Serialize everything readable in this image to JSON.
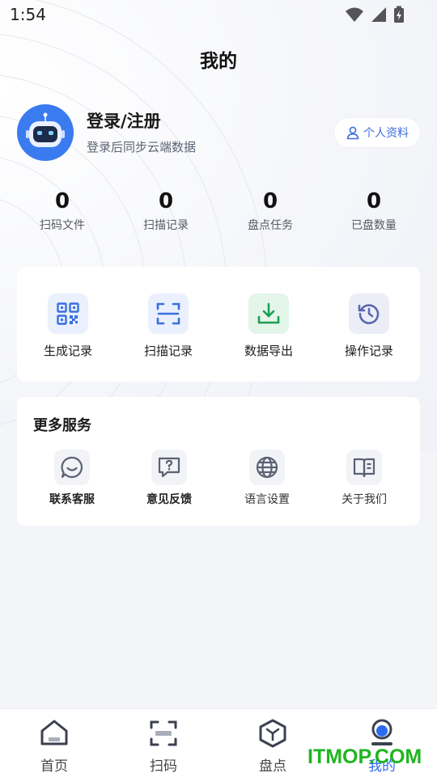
{
  "status_bar": {
    "time": "1:54"
  },
  "header": {
    "title": "我的"
  },
  "user": {
    "login_title": "登录/注册",
    "login_subtitle": "登录后同步云端数据",
    "profile_button": "个人资料"
  },
  "stats": [
    {
      "value": "0",
      "label": "扫码文件"
    },
    {
      "value": "0",
      "label": "扫描记录"
    },
    {
      "value": "0",
      "label": "盘点任务"
    },
    {
      "value": "0",
      "label": "已盘数量"
    }
  ],
  "tools": [
    {
      "label": "生成记录",
      "icon": "qrcode-icon",
      "color": "#3b6fe0",
      "bg": "#eaf0fd"
    },
    {
      "label": "扫描记录",
      "icon": "scan-frame-icon",
      "color": "#3b6fe0",
      "bg": "#eaf0fd"
    },
    {
      "label": "数据导出",
      "icon": "download-icon",
      "color": "#1e9e55",
      "bg": "#e4f5ea"
    },
    {
      "label": "操作记录",
      "icon": "history-icon",
      "color": "#5c68b0",
      "bg": "#eceef7"
    }
  ],
  "services": {
    "title": "更多服务",
    "items": [
      {
        "label": "联系客服",
        "icon": "chat-smile-icon"
      },
      {
        "label": "意见反馈",
        "icon": "feedback-icon"
      },
      {
        "label": "语言设置",
        "icon": "globe-icon"
      },
      {
        "label": "关于我们",
        "icon": "book-icon"
      }
    ]
  },
  "tabbar": {
    "items": [
      {
        "label": "首页",
        "icon": "home-icon"
      },
      {
        "label": "扫码",
        "icon": "scan-icon"
      },
      {
        "label": "盘点",
        "icon": "inventory-box-icon"
      },
      {
        "label": "我的",
        "icon": "profile-icon",
        "active": true
      }
    ]
  },
  "watermark": "ITMOP.COM",
  "colors": {
    "accent": "#2f6af0",
    "avatar_bg": "#3a7bf0",
    "watermark": "#1fb51f"
  }
}
